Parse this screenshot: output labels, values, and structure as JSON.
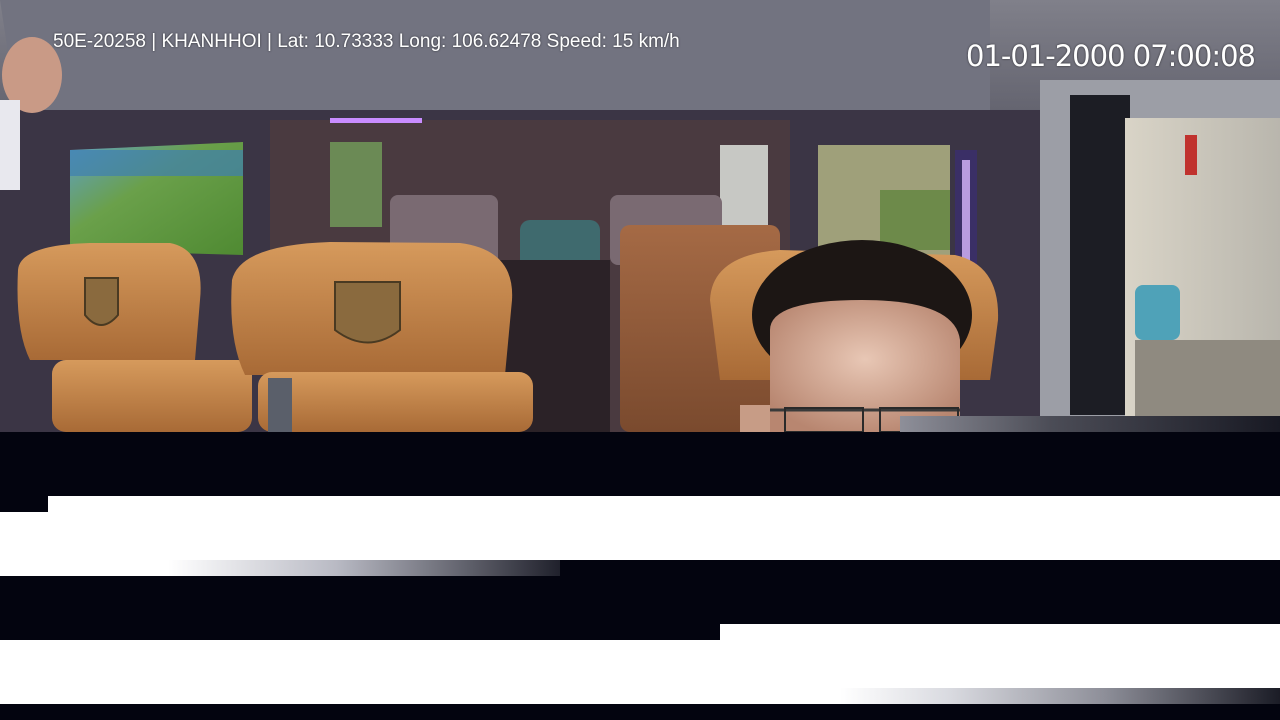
{
  "overlay": {
    "info_line": "50E-20258 | KHANHHOI | Lat: 10.73333 Long: 106.62478 Speed: 15 km/h",
    "timestamp": "01-01-2000 07:00:08"
  },
  "scene": {
    "description_tags": [
      "van-interior",
      "leather-seats",
      "driver",
      "side-window",
      "rear-windows"
    ],
    "colors": {
      "ceiling": "#6b6c78",
      "seat_leather": "#c98a4e",
      "window_green": "#5c9a3a",
      "accent_purple": "#9a6cff",
      "artifact_black": "#03040f",
      "artifact_white": "#ffffff"
    }
  }
}
